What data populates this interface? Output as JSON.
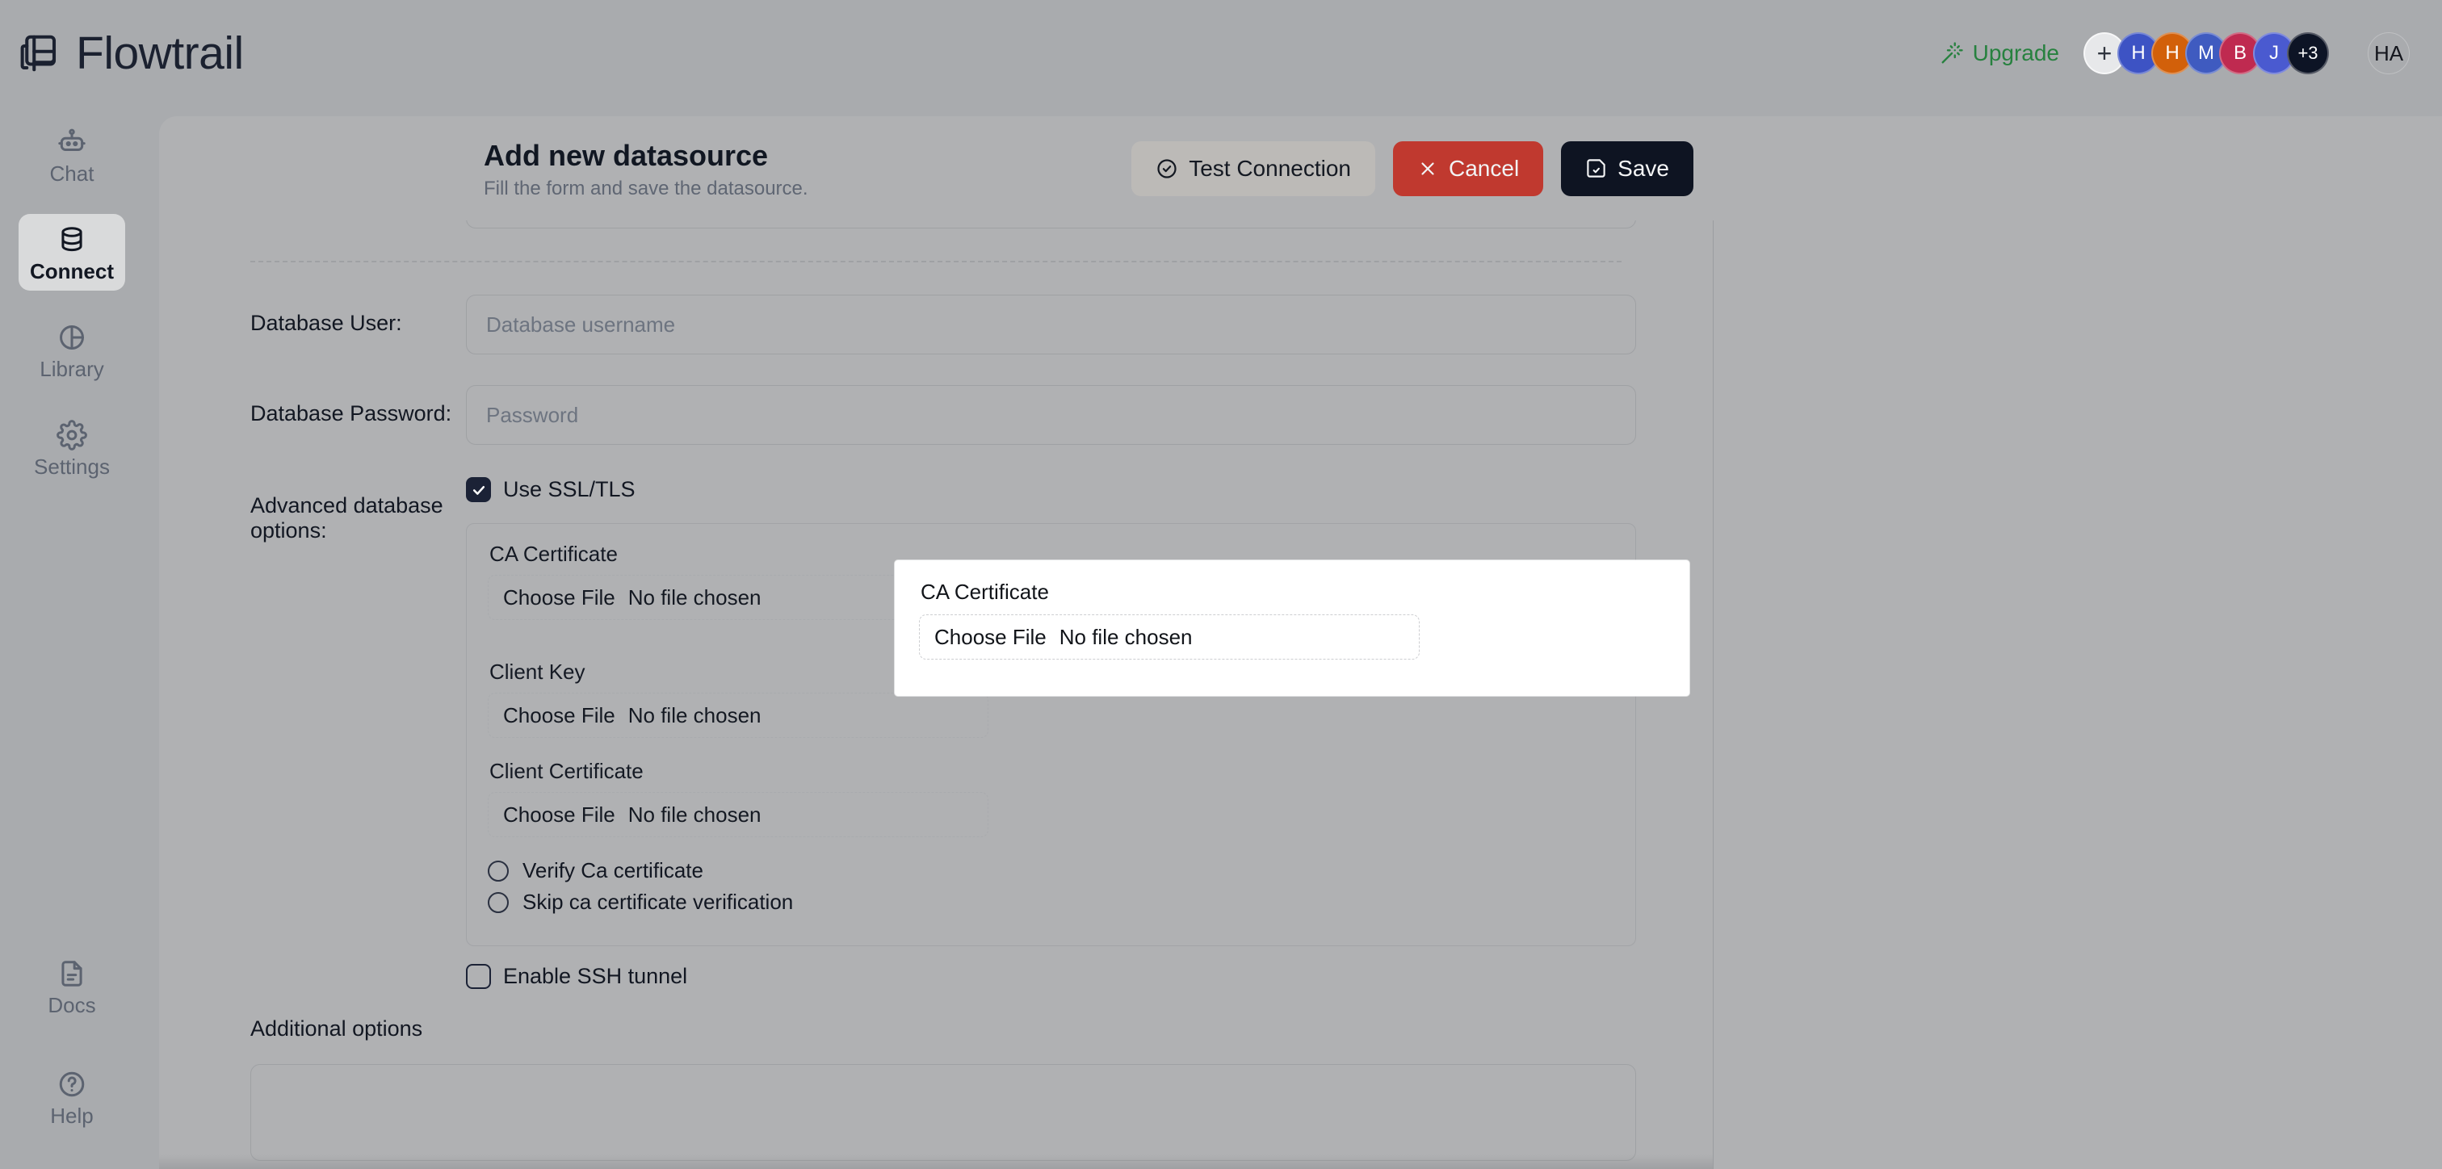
{
  "app": {
    "brand_name": "Flowtrail",
    "brand_icon": "flowtrail-logo-icon"
  },
  "topbar": {
    "upgrade_label": "Upgrade",
    "upgrade_icon": "magic-wand-sparkles-icon",
    "upgrade_color": "#27813f",
    "add_member_label": "+",
    "avatars": [
      {
        "initial": "H",
        "color": "#3d53c4"
      },
      {
        "initial": "H",
        "color": "#d2600a"
      },
      {
        "initial": "M",
        "color": "#3f5bc0"
      },
      {
        "initial": "B",
        "color": "#bf2a50"
      },
      {
        "initial": "J",
        "color": "#4a5ad0"
      },
      {
        "initial": "+3",
        "color": "#0d1425"
      }
    ],
    "user_initials": "HA"
  },
  "sidebar": {
    "items": [
      {
        "label": "Chat",
        "icon": "robot-icon",
        "active": false
      },
      {
        "label": "Connect",
        "icon": "database-icon",
        "active": true
      },
      {
        "label": "Library",
        "icon": "pie-chart-icon",
        "active": false
      },
      {
        "label": "Settings",
        "icon": "gear-icon",
        "active": false
      }
    ],
    "bottom_items": [
      {
        "label": "Docs",
        "icon": "document-icon"
      },
      {
        "label": "Help",
        "icon": "question-circle-icon"
      }
    ]
  },
  "page": {
    "title": "Add new datasource",
    "subtitle": "Fill the form and save the datasource.",
    "actions": {
      "test_connection_label": "Test Connection",
      "test_connection_icon": "check-circle-icon",
      "cancel_label": "Cancel",
      "cancel_icon": "close-x-icon",
      "cancel_color": "#c0392f",
      "save_label": "Save",
      "save_icon": "save-disk-icon",
      "save_color": "#0e1422"
    }
  },
  "form": {
    "fields": [
      {
        "label": "Database User:",
        "placeholder": "Database username"
      },
      {
        "label": "Database Password:",
        "placeholder": "Password"
      }
    ],
    "advanced": {
      "label": "Advanced database options:",
      "use_ssl": {
        "label": "Use SSL/TLS",
        "checked": true
      },
      "ca_certificate": {
        "label": "CA Certificate",
        "button_label": "Choose File",
        "status": "No file chosen",
        "highlighted": true
      },
      "client_key": {
        "label": "Client Key",
        "button_label": "Choose File",
        "status": "No file chosen"
      },
      "client_certificate": {
        "label": "Client Certificate",
        "button_label": "Choose File",
        "status": "No file chosen"
      },
      "verification_options": [
        {
          "label": "Verify Ca certificate",
          "selected": false
        },
        {
          "label": "Skip ca certificate verification",
          "selected": false
        }
      ],
      "ssh_tunnel": {
        "label": "Enable SSH tunnel",
        "checked": false
      }
    },
    "additional_options_label": "Additional options"
  }
}
